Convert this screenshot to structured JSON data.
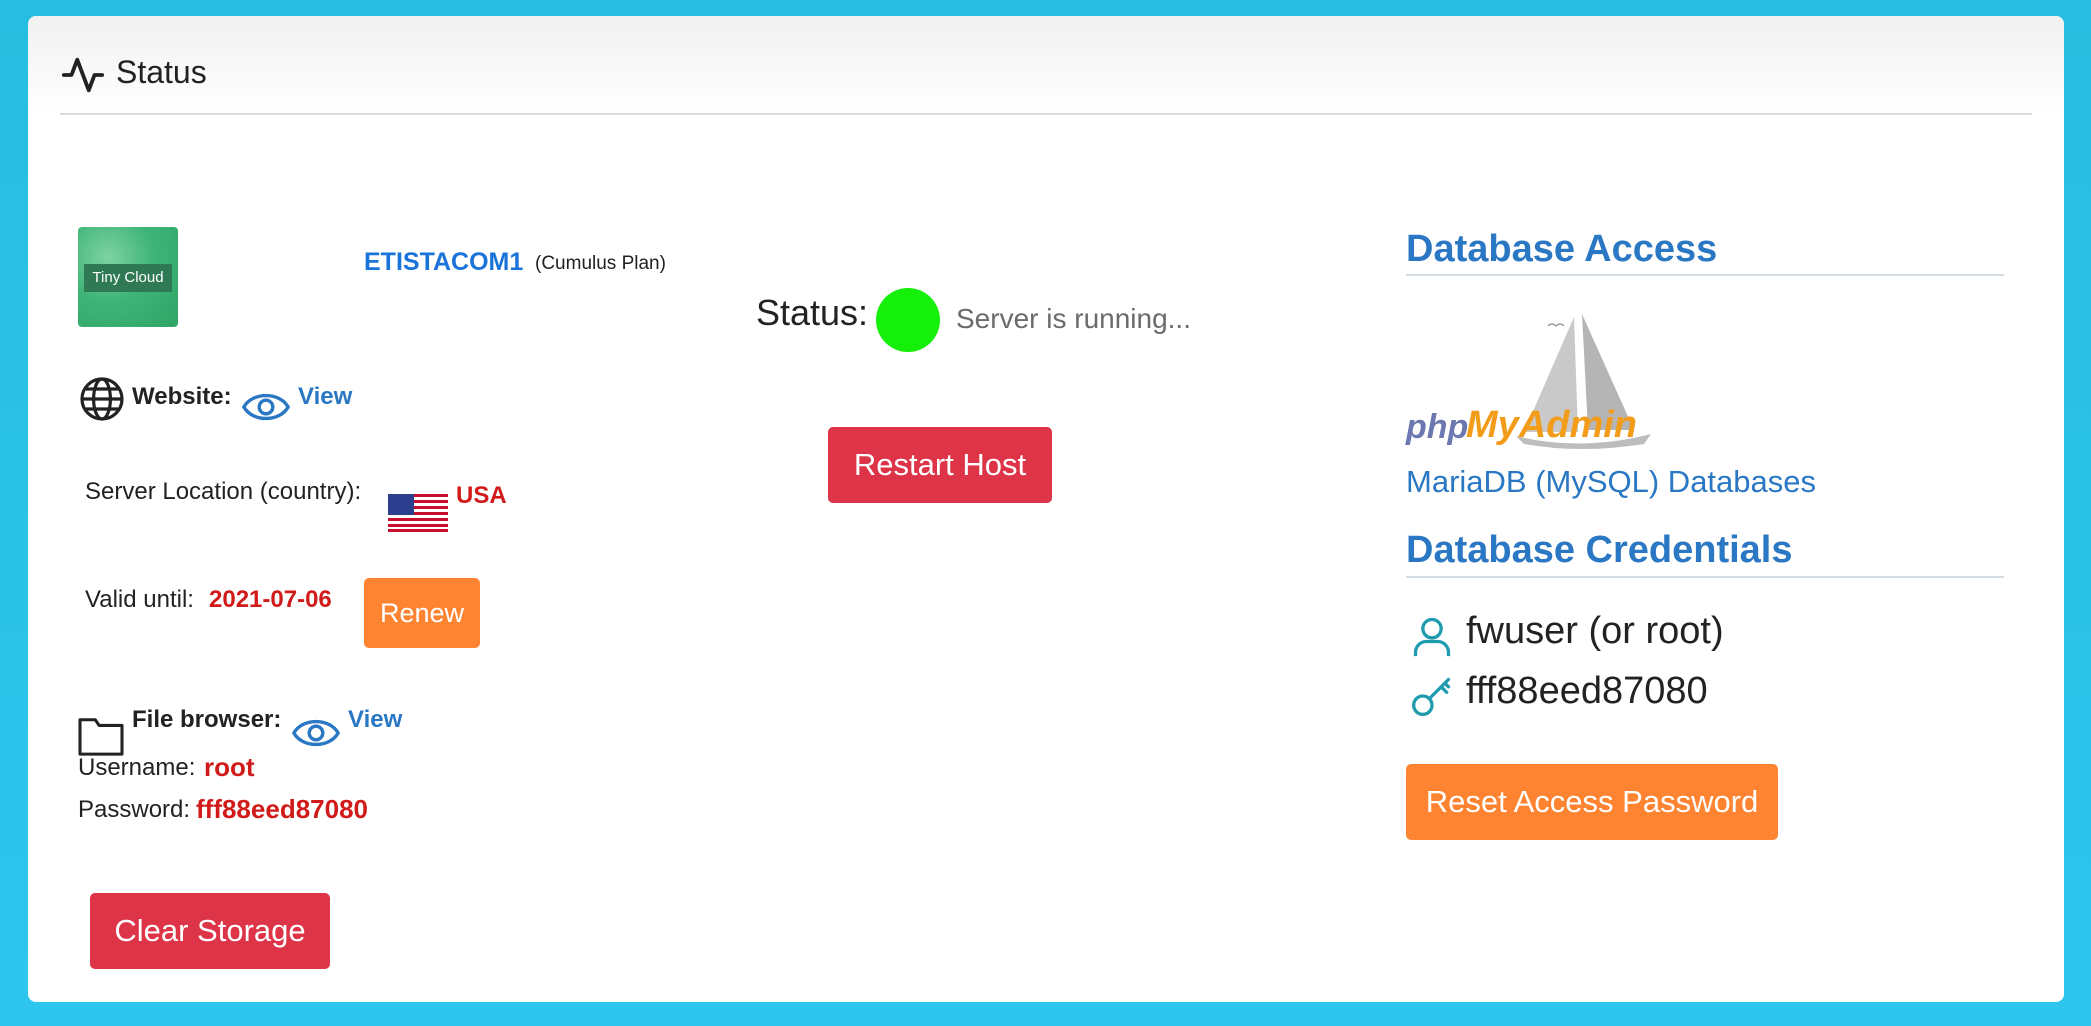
{
  "header": {
    "title": "Status",
    "icon": "activity-icon"
  },
  "account": {
    "logo_text": "Tiny Cloud",
    "name": "ETISTACOM1",
    "plan": "(Cumulus Plan)"
  },
  "website": {
    "label": "Website:",
    "link": "View"
  },
  "location": {
    "label": "Server Location (country):",
    "country": "USA"
  },
  "validity": {
    "label": "Valid until:",
    "date": "2021-07-06",
    "renew_label": "Renew"
  },
  "file_browser": {
    "label": "File browser:",
    "link": "View",
    "username_label": "Username:",
    "username": "root",
    "password_label": "Password:",
    "password": "fff88eed87080"
  },
  "clear_storage_label": "Clear Storage",
  "server": {
    "status_label": "Status:",
    "status_text": "Server is running...",
    "status_color": "#14f00a",
    "restart_label": "Restart Host"
  },
  "database_access": {
    "title": "Database Access",
    "logo_php": "php",
    "logo_myadmin": "MyAdmin",
    "link": "MariaDB (MySQL) Databases"
  },
  "database_credentials": {
    "title": "Database Credentials",
    "user": "fwuser (or root)",
    "password": "fff88eed87080",
    "reset_label": "Reset Access Password"
  },
  "colors": {
    "accent_blue": "#2a77c4",
    "orange": "#ff8431",
    "red": "#dd3447",
    "teal": "#1f9bb0",
    "background": "#2ec6ee"
  }
}
